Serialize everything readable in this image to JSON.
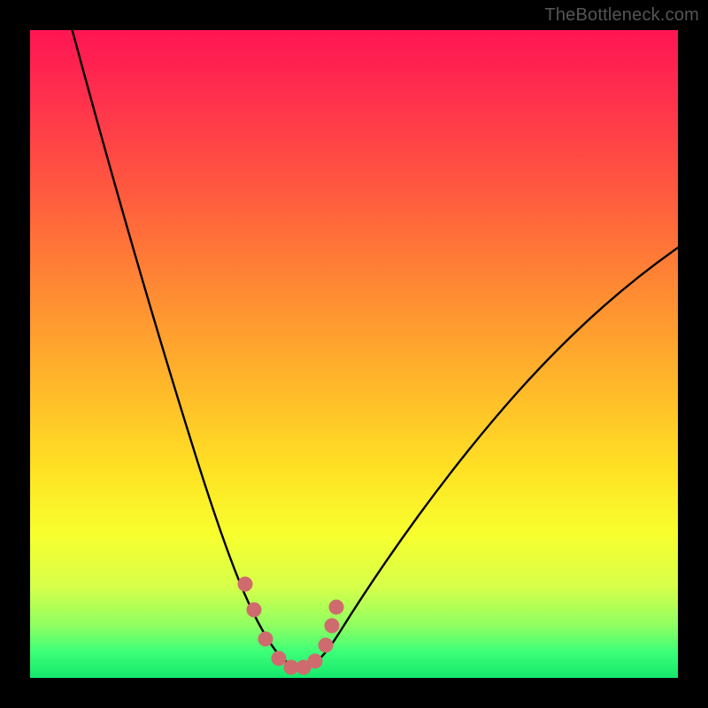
{
  "watermark": "TheBottleneck.com",
  "colors": {
    "gradient_top": "#ff1553",
    "gradient_bottom": "#15e86b",
    "curve": "#000000",
    "markers": "#cf6a6d",
    "frame": "#000000"
  },
  "chart_data": {
    "type": "line",
    "title": "",
    "xlabel": "",
    "ylabel": "",
    "xlim": [
      0,
      100
    ],
    "ylim": [
      0,
      100
    ],
    "series": [
      {
        "name": "bottleneck-curve",
        "x": [
          6,
          10,
          14,
          18,
          22,
          26,
          30,
          33,
          35,
          37,
          39,
          41,
          43,
          45,
          50,
          55,
          60,
          65,
          70,
          75,
          80,
          85,
          90,
          95,
          100
        ],
        "y": [
          100,
          88,
          76,
          64,
          52,
          40,
          28,
          18,
          12,
          7,
          3.5,
          1.8,
          1,
          1.5,
          5,
          12,
          20,
          28,
          35,
          42,
          48,
          54,
          59,
          63,
          67
        ]
      }
    ],
    "markers": {
      "name": "highlight-dots",
      "x_pct": [
        33.2,
        34.5,
        36.3,
        38.4,
        40.3,
        42.2,
        44.0,
        45.6,
        46.6,
        47.3
      ],
      "y_pct": [
        14.5,
        10.5,
        6.0,
        3.0,
        1.6,
        1.6,
        2.6,
        5.0,
        8.0,
        11.0
      ]
    }
  }
}
